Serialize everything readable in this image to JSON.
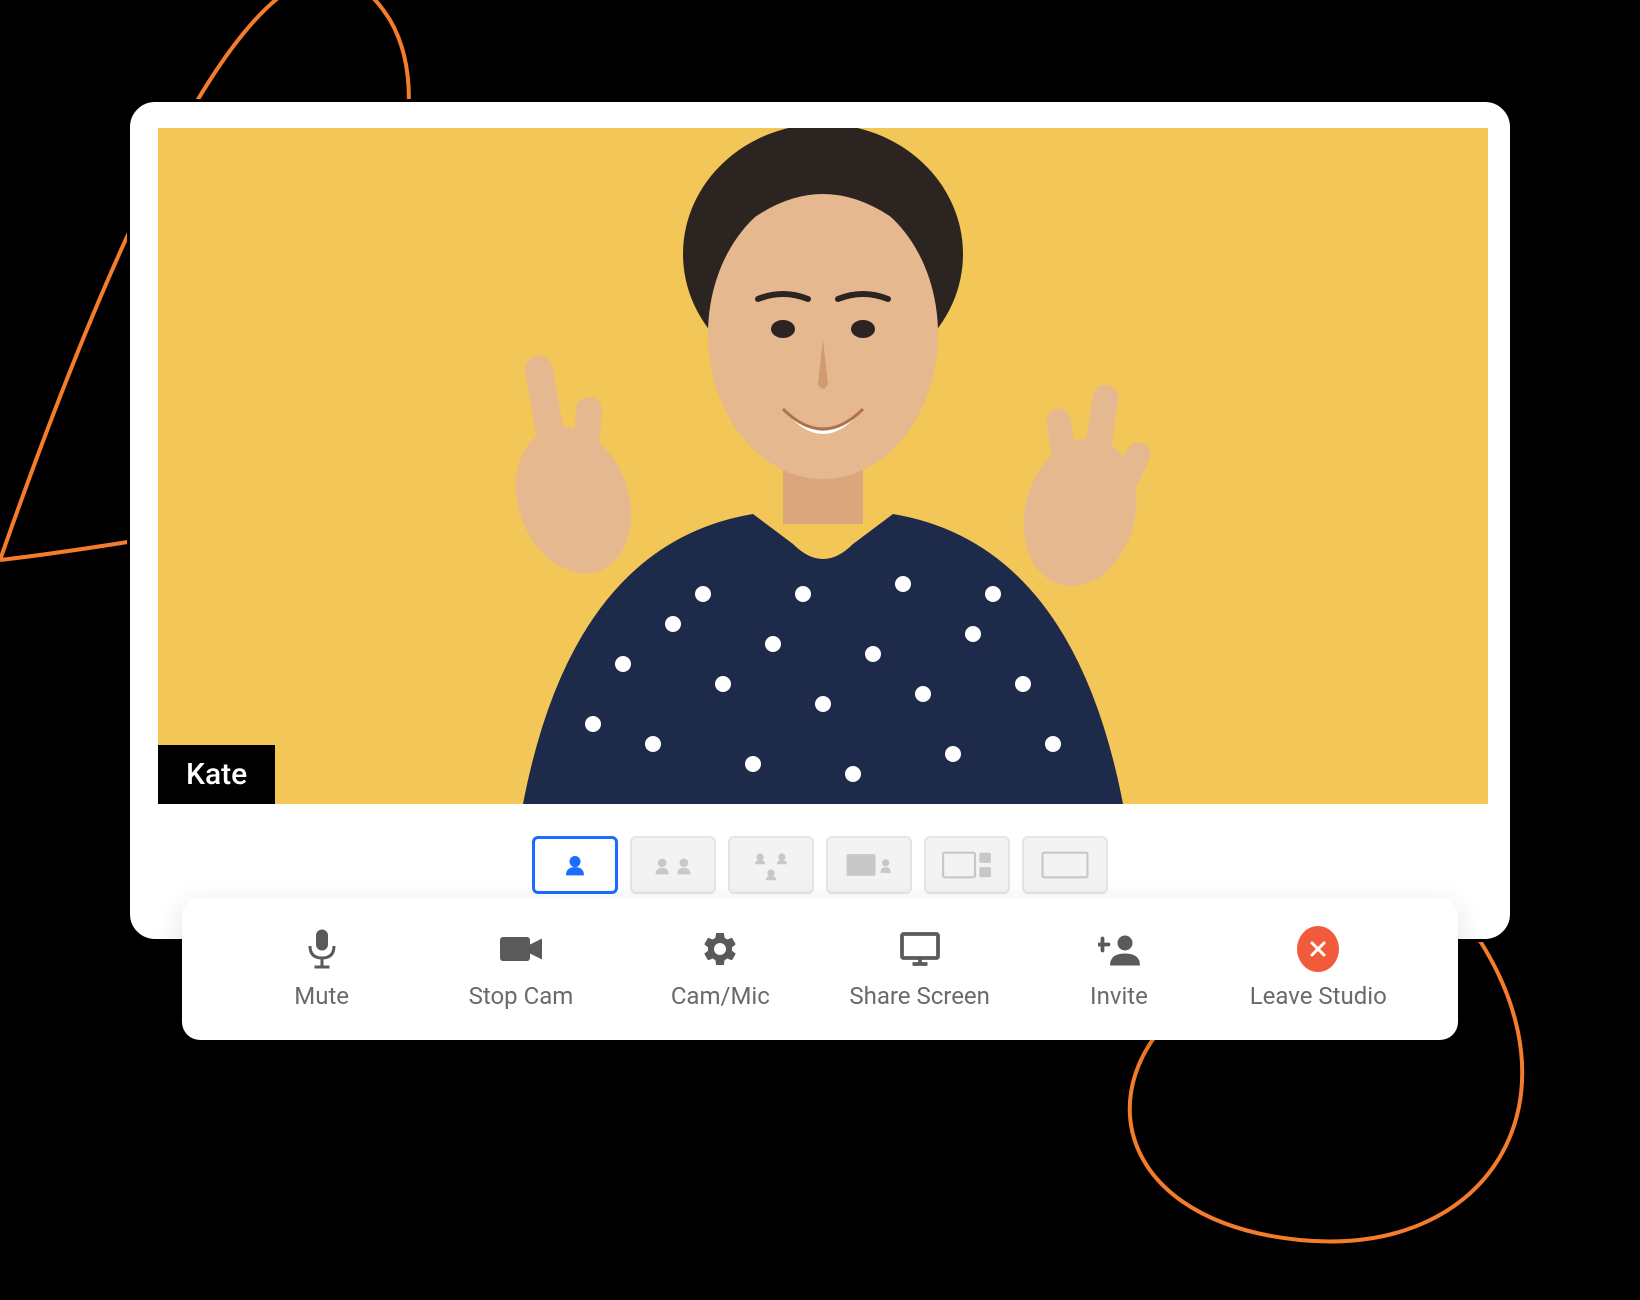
{
  "participant": {
    "name": "Kate"
  },
  "layouts": {
    "items": [
      {
        "id": "single",
        "active": true
      },
      {
        "id": "two-up",
        "active": false
      },
      {
        "id": "three-grid",
        "active": false
      },
      {
        "id": "screen-thumb",
        "active": false
      },
      {
        "id": "screen-side",
        "active": false
      },
      {
        "id": "full",
        "active": false
      }
    ]
  },
  "toolbar": {
    "mute": "Mute",
    "stopcam": "Stop Cam",
    "cammic": "Cam/Mic",
    "share": "Share Screen",
    "invite": "Invite",
    "leave": "Leave Studio"
  },
  "colors": {
    "accent": "#1A6DFF",
    "video_bg": "#F3C658",
    "leave": "#F15A3A",
    "swirl": "#F47C2B"
  }
}
